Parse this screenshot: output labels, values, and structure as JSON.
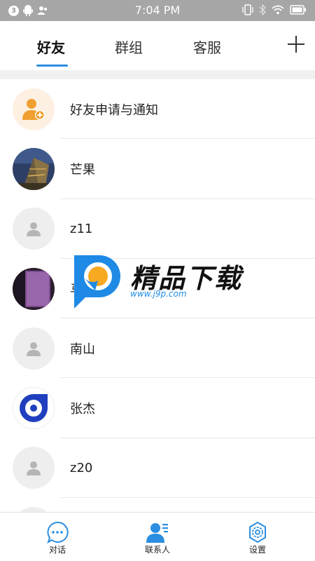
{
  "status_bar": {
    "notification_count": "3",
    "time": "7:04 PM"
  },
  "tabs": [
    {
      "label": "好友",
      "active": true
    },
    {
      "label": "群组",
      "active": false
    },
    {
      "label": "客服",
      "active": false
    }
  ],
  "contacts": [
    {
      "name": "好友申请与通知",
      "avatar": "add-friend-icon"
    },
    {
      "name": "芒果",
      "avatar": "photo"
    },
    {
      "name": "z11",
      "avatar": "default-user-icon"
    },
    {
      "name": "马云",
      "avatar": "photo"
    },
    {
      "name": "南山",
      "avatar": "default-user-icon"
    },
    {
      "name": "张杰",
      "avatar": "chat-logo"
    },
    {
      "name": "z20",
      "avatar": "default-user-icon"
    }
  ],
  "watermark": {
    "text": "精品下载",
    "url": "www.j9p.com"
  },
  "bottom_nav": [
    {
      "label": "对话",
      "icon": "chat-bubble-icon",
      "active": false
    },
    {
      "label": "联系人",
      "icon": "contacts-icon",
      "active": true
    },
    {
      "label": "设置",
      "icon": "settings-icon",
      "active": false
    }
  ],
  "colors": {
    "accent": "#2b8ee0",
    "status_bar": "#a6a6a6",
    "notice_orange": "#f0a030"
  }
}
